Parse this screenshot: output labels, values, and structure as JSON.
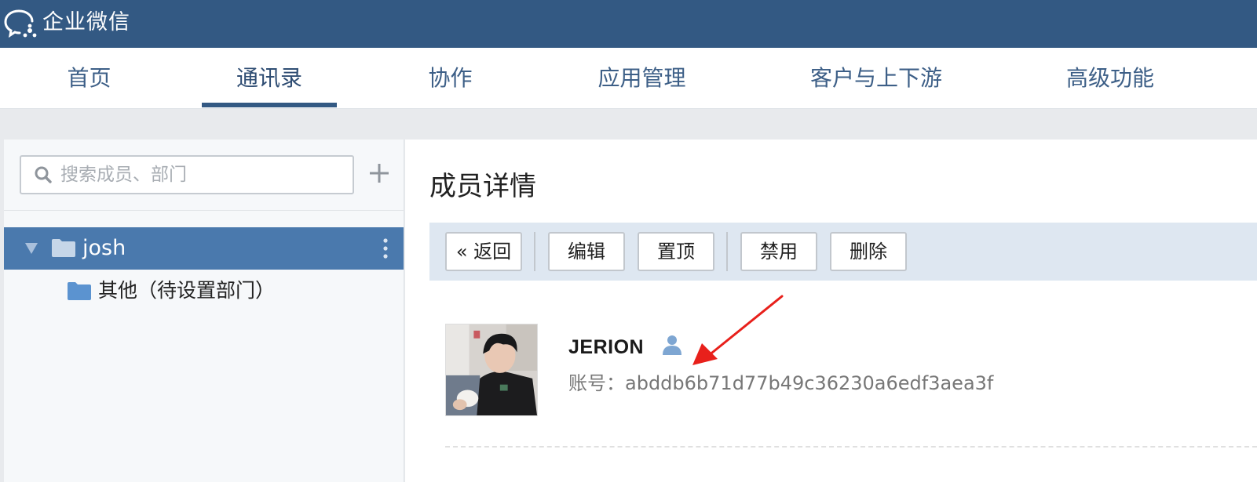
{
  "app": {
    "brand_name": "企业微信"
  },
  "nav": {
    "items": [
      {
        "label": "首页"
      },
      {
        "label": "通讯录",
        "active": true
      },
      {
        "label": "协作"
      },
      {
        "label": "应用管理"
      },
      {
        "label": "客户与上下游"
      },
      {
        "label": "高级功能"
      }
    ]
  },
  "sidebar": {
    "search_placeholder": "搜索成员、部门",
    "add_icon": "plus-icon",
    "tree": {
      "root_label": "josh",
      "children": [
        {
          "label": "其他（待设置部门）"
        }
      ]
    }
  },
  "main": {
    "title": "成员详情",
    "toolbar": {
      "back_label": "« 返回",
      "edit_label": "编辑",
      "pin_label": "置顶",
      "disable_label": "禁用",
      "delete_label": "删除"
    },
    "member": {
      "name": "JERION",
      "account_label": "账号：",
      "account_value": "abddb6b71d77b49c36230a6edf3aea3f"
    }
  },
  "colors": {
    "brand_bar": "#335983",
    "nav_text": "#3d5f87",
    "tree_selected": "#4a79ad",
    "toolbar_bg": "#dee7f1",
    "annotation_arrow": "#e8201b"
  }
}
